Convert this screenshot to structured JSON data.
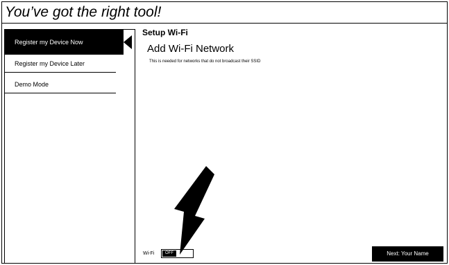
{
  "banner": {
    "title": "You’ve got the right tool!"
  },
  "sidebar": {
    "items": [
      {
        "label": "Register my Device Now",
        "active": true
      },
      {
        "label": "Register my Device Later",
        "active": false
      },
      {
        "label": "Demo Mode",
        "active": false
      }
    ]
  },
  "main": {
    "section_title": "Setup Wi-Fi",
    "heading": "Add Wi-Fi Network",
    "note": "This is needed for networks that do not broadcast their SSID"
  },
  "wifi": {
    "label": "Wi-Fi",
    "state": "OFF"
  },
  "next_button": {
    "label": "Next: Your Name"
  },
  "annotation": {
    "icon": "arrow-pointer-icon",
    "color": "#000000"
  }
}
